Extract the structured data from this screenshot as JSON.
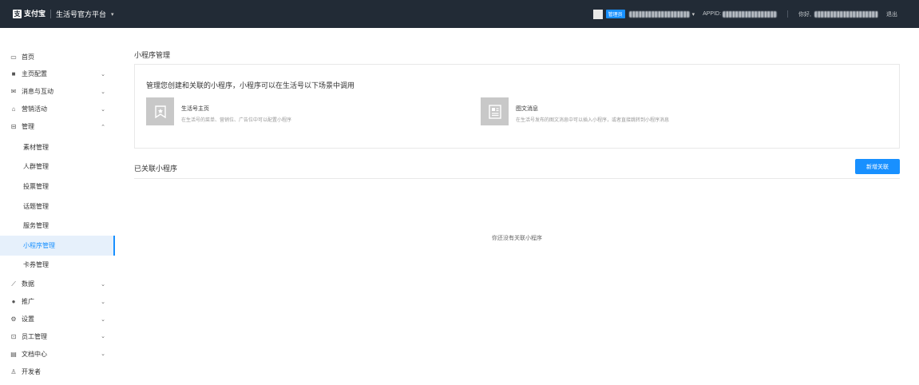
{
  "topbar": {
    "logo_text": "支付宝",
    "logo_mark": "支",
    "platform_name": "生活号官方平台",
    "platform_caret": "▾",
    "admin_badge": "管理员",
    "appid_label": "APPID:",
    "greeting": "你好,",
    "logout": "退出"
  },
  "sidebar": {
    "items": [
      {
        "icon": "▭",
        "icon_name": "monitor-icon",
        "label": "首页",
        "arrow": ""
      },
      {
        "icon": "■",
        "icon_name": "grid-icon",
        "label": "主页配置",
        "arrow": "⌄"
      },
      {
        "icon": "✉",
        "icon_name": "mail-icon",
        "label": "消息与互动",
        "arrow": "⌄"
      },
      {
        "icon": "⌂",
        "icon_name": "gift-icon",
        "label": "营销活动",
        "arrow": "⌄"
      },
      {
        "icon": "⊟",
        "icon_name": "manage-icon",
        "label": "管理",
        "arrow": "⌃"
      }
    ],
    "sub_items": [
      {
        "label": "素材管理"
      },
      {
        "label": "人群管理"
      },
      {
        "label": "投票管理"
      },
      {
        "label": "话题管理"
      },
      {
        "label": "服务管理"
      },
      {
        "label": "小程序管理"
      },
      {
        "label": "卡券管理"
      }
    ],
    "bottom_items": [
      {
        "icon": "⟋",
        "icon_name": "chart-icon",
        "label": "数据",
        "arrow": "⌄"
      },
      {
        "icon": "●",
        "icon_name": "promote-icon",
        "label": "推广",
        "arrow": "⌄"
      },
      {
        "icon": "⚙",
        "icon_name": "settings-icon",
        "label": "设置",
        "arrow": "⌄"
      },
      {
        "icon": "⊡",
        "icon_name": "staff-icon",
        "label": "员工管理",
        "arrow": "⌄"
      },
      {
        "icon": "▤",
        "icon_name": "document-icon",
        "label": "文档中心",
        "arrow": "⌄"
      },
      {
        "icon": "♙",
        "icon_name": "developer-icon",
        "label": "开发者",
        "arrow": ""
      }
    ]
  },
  "main": {
    "page_title": "小程序管理",
    "intro_title": "管理您创建和关联的小程序，小程序可以在生活号以下场景中调用",
    "features": [
      {
        "title": "生活号主页",
        "desc": "在生活号的菜单、营销位、广告位中可以配置小程序"
      },
      {
        "title": "图文消息",
        "desc": "在生活号发布的图文消息中可以插入小程序，或者直接跳转到小程序消息"
      }
    ],
    "linked_title": "已关联小程序",
    "add_button": "新增关联",
    "empty_text": "你还没有关联小程序"
  },
  "colors": {
    "topbar_bg": "#222b36",
    "accent": "#1890ff",
    "active_bg": "#e6f0fb"
  }
}
